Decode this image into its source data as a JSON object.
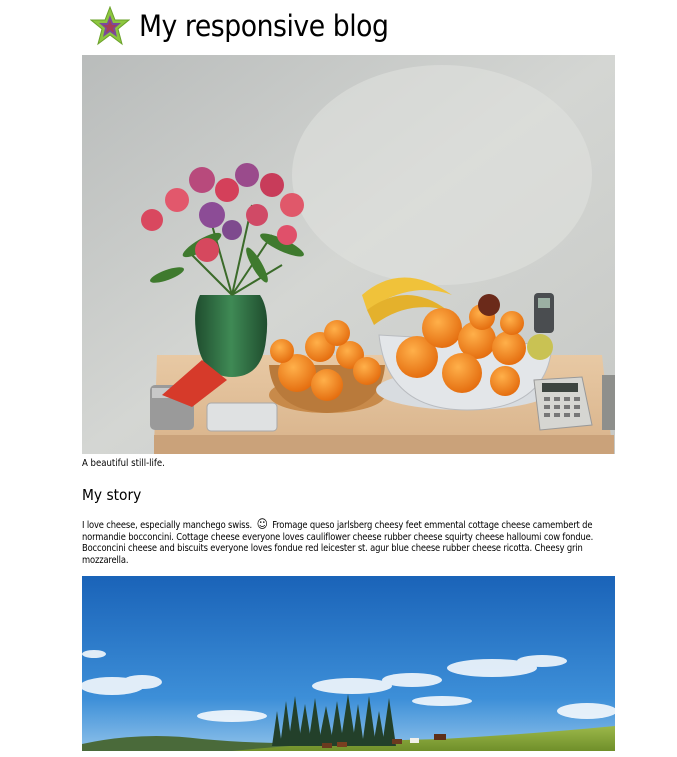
{
  "header": {
    "logo": "star-logo",
    "title": "My responsive blog"
  },
  "figure_1": {
    "image": "still-life-photo",
    "caption": "A beautiful still-life."
  },
  "story": {
    "heading": "My story",
    "text_before_icon": "I love cheese, especially manchego swiss.",
    "icon": "smiley-face-icon",
    "text_after_icon": "Fromage queso jarlsberg cheesy feet emmental cottage cheese camembert de normandie bocconcini. Cottage cheese everyone loves cauliflower cheese rubber cheese squirty cheese halloumi cow fondue. Bocconcini cheese and biscuits everyone loves fondue red leicester st. agur blue cheese rubber cheese ricotta. Cheesy grin mozzarella."
  },
  "figure_2": {
    "image": "landscape-photo"
  },
  "colors": {
    "star_outer": "#8dc63f",
    "star_inner": "#7b4a9b",
    "sky": "#1e6fc2",
    "wall": "#c9cbc8"
  }
}
